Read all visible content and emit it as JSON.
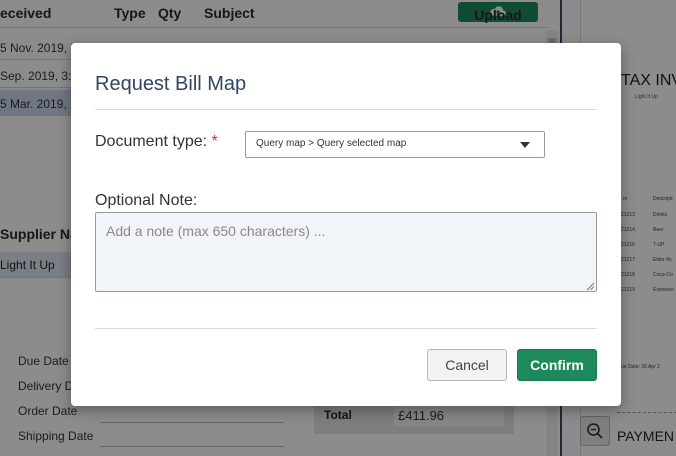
{
  "background": {
    "table_header": {
      "received": "eceived",
      "type": "Type",
      "qty": "Qty",
      "subject": "Subject"
    },
    "upload_label": "Upload",
    "rows": [
      {
        "received": "5 Nov. 2019, 3:"
      },
      {
        "received": "Sep. 2019, 3:1"
      },
      {
        "received": "5 Mar. 2019, 2"
      }
    ],
    "supplier_header": "Supplier Na",
    "supplier_value": "Light It Up",
    "fields": [
      "Due Date",
      "Delivery D",
      "Order Date",
      "Shipping Date"
    ],
    "totals": {
      "label": "Total",
      "value": "£411.96"
    },
    "invoice": {
      "title": "TAX INV",
      "subtitle": "Light It Up",
      "col_item": "m",
      "col_desc": "Descripti",
      "rows": [
        {
          "code": "21213",
          "desc": "Drinks"
        },
        {
          "code": "21214",
          "desc": "Beer"
        },
        {
          "code": "21215",
          "desc": "7-UP"
        },
        {
          "code": "21217",
          "desc": "Elder-flo"
        },
        {
          "code": "21218",
          "desc": "Coca-Co"
        },
        {
          "code": "21219",
          "desc": "Espresso"
        }
      ],
      "due": "ue Date: 30 Apr 2",
      "payment": "PAYMEN"
    }
  },
  "modal": {
    "title": "Request Bill Map",
    "document_type_label": "Document type:",
    "required_mark": "*",
    "document_type_value": "Query map > Query selected map",
    "note_label": "Optional Note:",
    "note_placeholder": "Add a note (max 650 characters) ...",
    "cancel_label": "Cancel",
    "confirm_label": "Confirm"
  },
  "colors": {
    "accent_green": "#1d8a5c",
    "title_blue": "#2f4860",
    "required_red": "#d0322e",
    "selected_row": "#cdd8ee"
  }
}
